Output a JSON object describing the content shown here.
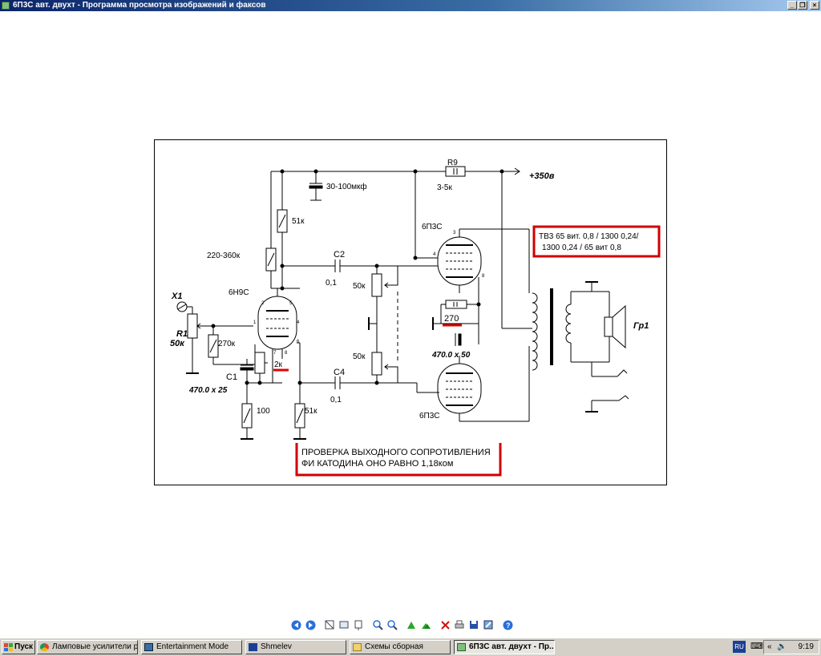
{
  "window": {
    "title": "6П3С авт. двухт - Программа просмотра изображений и факсов",
    "controls": [
      "_",
      "❐",
      "×"
    ]
  },
  "schematic": {
    "labels": {
      "r9": "R9",
      "r9_value": "3-5к",
      "supply": "+350в",
      "cap_top": "30-100мкф",
      "r_51k_top": "51к",
      "r_220": "220-360к",
      "c2": "C2",
      "c2_value": "0,1",
      "tube_driver": "6Н9С",
      "x1": "X1",
      "r1": "R1",
      "r1_value": "50к",
      "r_270k": "270к",
      "c1": "C1",
      "c1_value": "470.0 х 25",
      "r_2k": "2к",
      "r_100": "100",
      "r_51k_bot": "51к",
      "c4": "C4",
      "c4_value": "0,1",
      "pot_top": "50к",
      "pot_bot": "50к",
      "tube_top": "6П3С",
      "tube_bot": "6П3С",
      "r_270": "270",
      "cap_cathode": "470.0 х 50",
      "speaker": "Гр1",
      "pin3": "3",
      "pin4": "4",
      "pin5": "5",
      "pin8": "8",
      "pin2": "2",
      "pin7": "7",
      "pin1": "1",
      "pin6": "6"
    },
    "note_transformer_line1": "ТВ3  65 вит. 0,8 / 1300  0,24/",
    "note_transformer_line2": "1300  0,24 /  65 вит 0,8",
    "note_bottom_line1": "ПРОВЕРКА  ВЫХОДНОГО  СОПРОТИВЛЕНИЯ",
    "note_bottom_line2": "ФИ  КАТОДИНА  ОНО  РАВНО  1,18ком",
    "highlight_color": "#e00000"
  },
  "toolbar": {
    "buttons": [
      "prev",
      "next",
      "best-fit",
      "actual-size",
      "slideshow",
      "zoom-in",
      "zoom-out",
      "rotate-cw",
      "rotate-ccw",
      "delete",
      "print",
      "save",
      "edit",
      "help"
    ]
  },
  "taskbar": {
    "start": "Пуск",
    "tasks": [
      "Ламповые усилители р...",
      "Entertainment Mode",
      "Shmelev",
      "Схемы сборная",
      "6П3С авт. двухт - Пр..."
    ],
    "lang": "RU",
    "chevron": "«",
    "time": "9:19"
  }
}
